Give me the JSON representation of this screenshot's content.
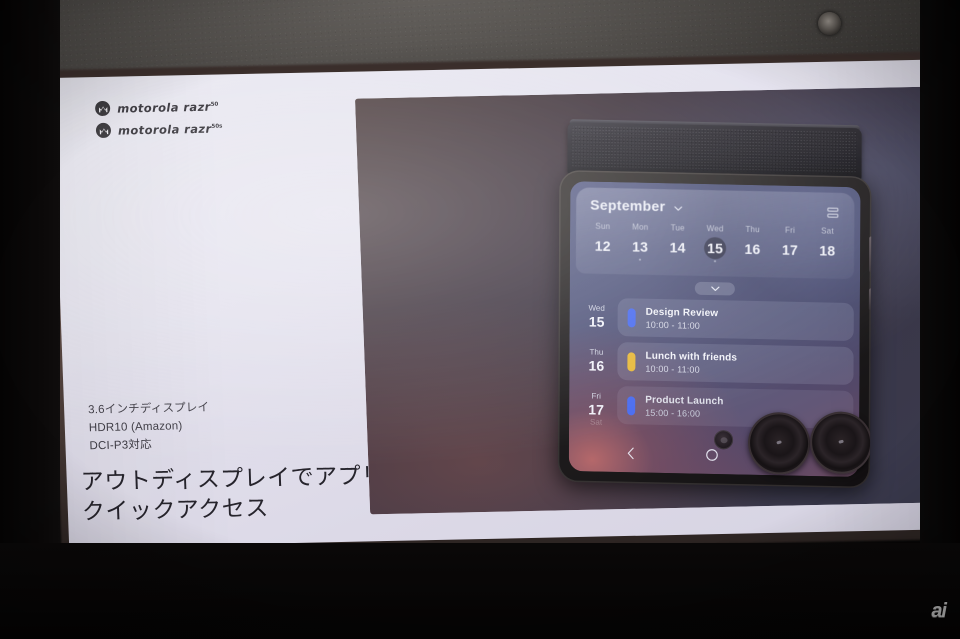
{
  "scene": {
    "type": "projected-presentation-slide-photo",
    "watermark": "ai"
  },
  "slide": {
    "logos": [
      {
        "mark": "motorola-batwing-icon",
        "text": "motorola razr",
        "superscript": "50"
      },
      {
        "mark": "motorola-batwing-icon",
        "text": "motorola razr",
        "superscript": "50s"
      }
    ],
    "specs": [
      "3.6インチディスプレイ",
      "HDR10 (Amazon)",
      "DCI-P3対応"
    ],
    "headline": "アウトディスプレイでアプリにクイックアクセス",
    "colors": {
      "slide_bg": "#e4e2ee",
      "panel_bg": "#3c3748",
      "text": "#26242c",
      "spec_text": "#3b3942",
      "event_blue": "#4a6cf0",
      "event_yellow": "#e8b93a"
    }
  },
  "phone": {
    "device": "motorola razr (folded)",
    "outer_display": {
      "app": "calendar",
      "header": {
        "month": "September",
        "chevron_icon": "chevron-down-icon",
        "view_toggle_icon": "agenda-view-icon"
      },
      "week": [
        {
          "dow": "Sun",
          "date": "12",
          "today": false,
          "dot": false
        },
        {
          "dow": "Mon",
          "date": "13",
          "today": false,
          "dot": true
        },
        {
          "dow": "Tue",
          "date": "14",
          "today": false,
          "dot": false
        },
        {
          "dow": "Wed",
          "date": "15",
          "today": true,
          "dot": true
        },
        {
          "dow": "Thu",
          "date": "16",
          "today": false,
          "dot": false
        },
        {
          "dow": "Fri",
          "date": "17",
          "today": false,
          "dot": false
        },
        {
          "dow": "Sat",
          "date": "18",
          "today": false,
          "dot": false
        }
      ],
      "expand_icon": "chevron-down-icon",
      "events": [
        {
          "dow": "Wed",
          "date": "15",
          "title": "Design Review",
          "time": "10:00 - 11:00",
          "color": "#4a6cf0"
        },
        {
          "dow": "Thu",
          "date": "16",
          "title": "Lunch with friends",
          "time": "10:00 - 11:00",
          "color": "#e8b93a"
        },
        {
          "dow": "Fri",
          "date": "17",
          "title": "Product Launch",
          "time": "15:00 - 16:00",
          "color": "#4a6cf0"
        }
      ],
      "partial_row_label": "Sat",
      "navbar": [
        {
          "icon": "back-icon"
        },
        {
          "icon": "home-icon"
        },
        {
          "icon": "recents-icon"
        }
      ]
    },
    "cameras": {
      "lens_count": 2,
      "flash_icon": "flash-sensor-icon"
    }
  }
}
